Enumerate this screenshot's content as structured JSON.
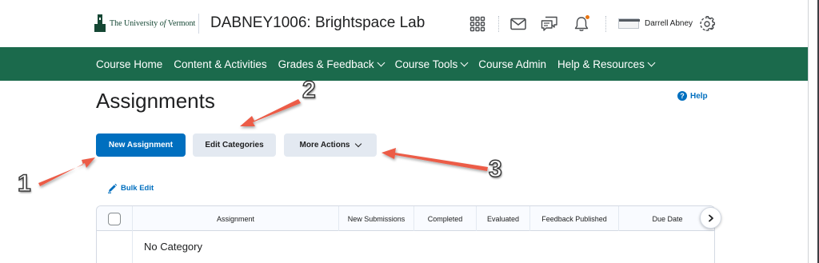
{
  "header": {
    "logo_text_prefix": "The University ",
    "logo_text_italic": "of",
    "logo_text_suffix": " Vermont",
    "course_title": "DABNEY1006: Brightspace Lab",
    "user_name": "Darrell Abney"
  },
  "nav": {
    "items": [
      {
        "label": "Course Home"
      },
      {
        "label": "Content & Activities"
      },
      {
        "label": "Grades & Feedback"
      },
      {
        "label": "Course Tools"
      },
      {
        "label": "Course Admin"
      },
      {
        "label": "Help & Resources"
      }
    ]
  },
  "page": {
    "title": "Assignments",
    "help_label": "Help",
    "help_glyph": "?"
  },
  "toolbar": {
    "new_assignment": "New Assignment",
    "edit_categories": "Edit Categories",
    "more_actions": "More Actions",
    "bulk_edit": "Bulk Edit"
  },
  "table": {
    "columns": [
      "Assignment",
      "New Submissions",
      "Completed",
      "Evaluated",
      "Feedback Published",
      "Due Date"
    ],
    "category_row": "No Category"
  },
  "annotations": {
    "labels": [
      "1",
      "2",
      "3"
    ]
  },
  "colors": {
    "nav_bg": "#1b6a4c",
    "brand_green": "#154734",
    "primary": "#006fbf",
    "secondary_btn": "#e3e9f1",
    "notification": "#e87511",
    "arrow": "#ec5b47"
  },
  "icons": {
    "apps": "grid-icon",
    "mail": "envelope-icon",
    "chat": "chat-icon",
    "notifications": "bell-icon",
    "settings": "gear-icon",
    "help": "help-circle-icon",
    "bulk_edit": "pencil-icon",
    "scroll": "chevron-right-icon",
    "dropdown": "chevron-down-icon"
  }
}
